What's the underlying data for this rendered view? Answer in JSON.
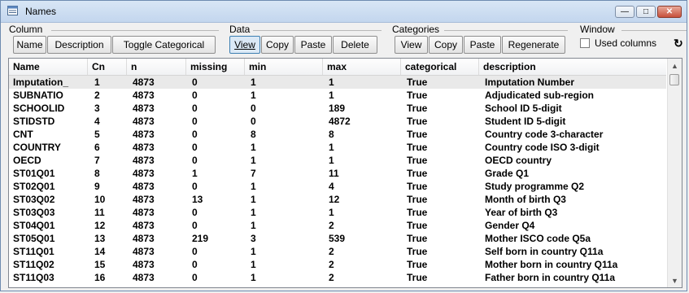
{
  "window": {
    "title": "Names",
    "minimize_glyph": "—",
    "maximize_glyph": "□",
    "close_glyph": "✕"
  },
  "toolbar": {
    "column": {
      "label": "Column",
      "buttons": [
        "Name",
        "Description",
        "Toggle Categorical"
      ]
    },
    "data": {
      "label": "Data",
      "buttons": [
        "View",
        "Copy",
        "Paste",
        "Delete"
      ]
    },
    "categories": {
      "label": "Categories",
      "buttons": [
        "View",
        "Copy",
        "Paste",
        "Regenerate"
      ]
    },
    "window_group": {
      "label": "Window",
      "used_columns_label": "Used columns",
      "used_columns_checked": false,
      "refresh_glyph": "↻"
    }
  },
  "table": {
    "columns": [
      "Name",
      "Cn",
      "n",
      "missing",
      "min",
      "max",
      "categorical",
      "description"
    ],
    "rows": [
      [
        "Imputation_",
        "1",
        "4873",
        "0",
        "1",
        "1",
        "True",
        "Imputation Number"
      ],
      [
        "SUBNATIO",
        "2",
        "4873",
        "0",
        "1",
        "1",
        "True",
        "Adjudicated sub-region"
      ],
      [
        "SCHOOLID",
        "3",
        "4873",
        "0",
        "0",
        "189",
        "True",
        "School ID 5-digit"
      ],
      [
        "STIDSTD",
        "4",
        "4873",
        "0",
        "0",
        "4872",
        "True",
        "Student ID 5-digit"
      ],
      [
        "CNT",
        "5",
        "4873",
        "0",
        "8",
        "8",
        "True",
        "Country code 3-character"
      ],
      [
        "COUNTRY",
        "6",
        "4873",
        "0",
        "1",
        "1",
        "True",
        "Country code ISO 3-digit"
      ],
      [
        "OECD",
        "7",
        "4873",
        "0",
        "1",
        "1",
        "True",
        "OECD country"
      ],
      [
        "ST01Q01",
        "8",
        "4873",
        "1",
        "7",
        "11",
        "True",
        "Grade Q1"
      ],
      [
        "ST02Q01",
        "9",
        "4873",
        "0",
        "1",
        "4",
        "True",
        "Study programme Q2"
      ],
      [
        "ST03Q02",
        "10",
        "4873",
        "13",
        "1",
        "12",
        "True",
        "Month of birth Q3"
      ],
      [
        "ST03Q03",
        "11",
        "4873",
        "0",
        "1",
        "1",
        "True",
        "Year of birth Q3"
      ],
      [
        "ST04Q01",
        "12",
        "4873",
        "0",
        "1",
        "2",
        "True",
        "Gender Q4"
      ],
      [
        "ST05Q01",
        "13",
        "4873",
        "219",
        "3",
        "539",
        "True",
        "Mother ISCO code Q5a"
      ],
      [
        "ST11Q01",
        "14",
        "4873",
        "0",
        "1",
        "2",
        "True",
        "Self born in country Q11a"
      ],
      [
        "ST11Q02",
        "15",
        "4873",
        "0",
        "1",
        "2",
        "True",
        "Mother born in country Q11a"
      ],
      [
        "ST11Q03",
        "16",
        "4873",
        "0",
        "1",
        "2",
        "True",
        "Father born in country Q11a"
      ]
    ]
  }
}
